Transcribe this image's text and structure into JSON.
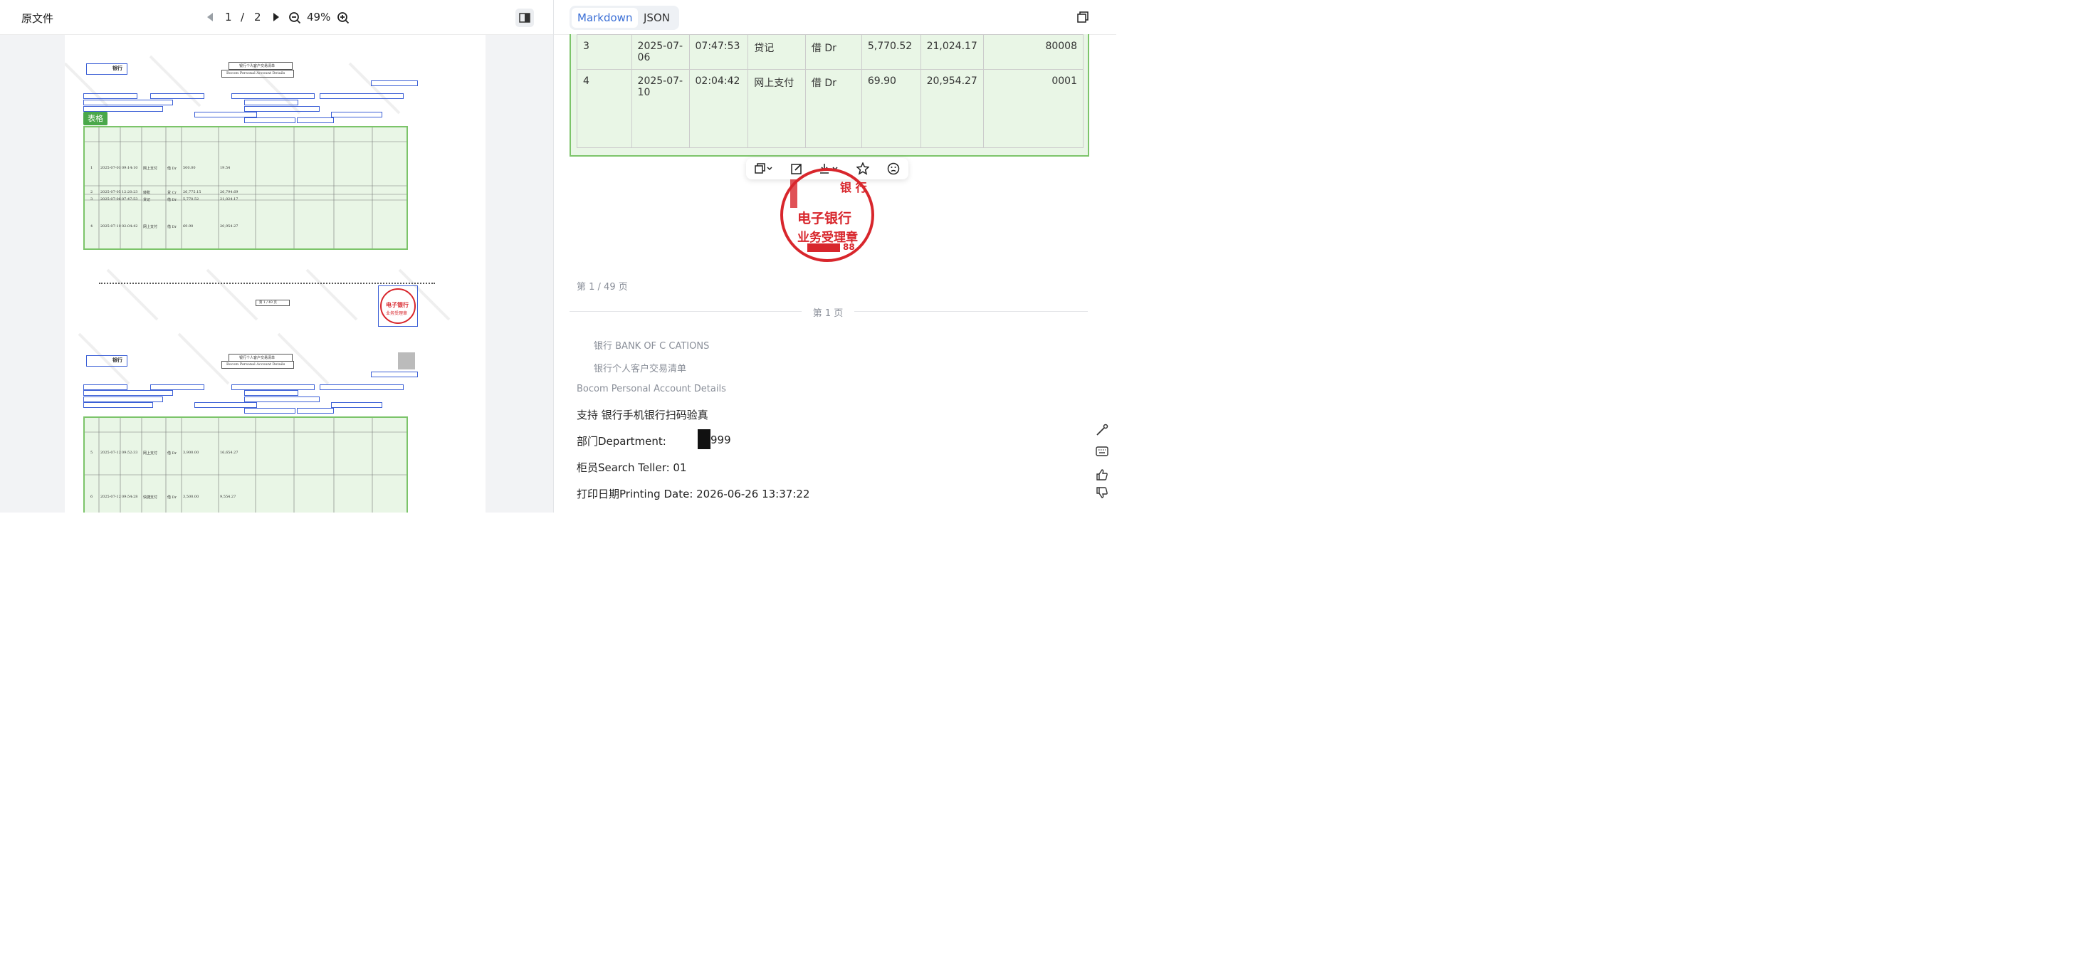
{
  "left": {
    "title": "原文件",
    "page_current": "1",
    "page_sep": "/",
    "page_total": "2",
    "zoom": "49%",
    "tag_label": "表格"
  },
  "scan": {
    "bank_logo": "银行",
    "title_cn": "银行个人客户交易清单",
    "title_en": "Bocom Personal Account Details",
    "seal_text_1": "电子银行",
    "seal_text_2": "业务受理章",
    "page_mark": "第 1 / 49 页",
    "rows": [
      {
        "serial": "1",
        "date": "2025-07-01",
        "time": "09:14:10",
        "type": "网上支付",
        "flag": "借 Dr",
        "amount": "500.00",
        "balance": "19.54"
      },
      {
        "serial": "2",
        "date": "2025-07-05",
        "time": "12:20:23",
        "type": "转账",
        "flag": "贷 Cr",
        "amount": "26,775.15",
        "balance": "26,794.69"
      },
      {
        "serial": "3",
        "date": "2025-07-06",
        "time": "07:47:53",
        "type": "贷记",
        "flag": "借 Dr",
        "amount": "5,770.52",
        "balance": "21,024.17"
      },
      {
        "serial": "4",
        "date": "2025-07-10",
        "time": "02:04:42",
        "type": "网上支付",
        "flag": "借 Dr",
        "amount": "69.90",
        "balance": "20,954.27"
      }
    ],
    "rows2": [
      {
        "serial": "5",
        "date": "2025-07-12",
        "time": "09:52:33",
        "type": "网上支付",
        "flag": "借 Dr",
        "amount": "3,900.00",
        "balance": "16,654.27"
      },
      {
        "serial": "6",
        "date": "2025-07-12",
        "time": "09:54:28",
        "type": "快捷支付",
        "flag": "借 Dr",
        "amount": "3,500.00",
        "balance": "9,554.27"
      }
    ]
  },
  "right": {
    "tab_markdown": "Markdown",
    "tab_json": "JSON",
    "table_rows": [
      {
        "c1": "3",
        "c2": "2025-07-06",
        "c3": "07:47:53",
        "c4": "贷记",
        "c5": "借 Dr",
        "c6": "5,770.52",
        "c7": "21,024.17",
        "c8": "80008"
      },
      {
        "c1": "4",
        "c2": "2025-07-10",
        "c3": "02:04:42",
        "c4": "网上支付",
        "c5": "借 Dr",
        "c6": "69.90",
        "c7": "20,954.27",
        "c8": "0001"
      }
    ],
    "seal_top": "银 行",
    "seal_line1": "电子银行",
    "seal_line2": "业务受理章",
    "seal_num": "88",
    "page_note": "第 1 / 49 页",
    "divider_label": "第 1 页",
    "line_bank": "银行 BANK OF C        CATIONS",
    "line_list_title": "银行个人客户交易清单",
    "line_en_title": "Bocom Personal Account Details",
    "line_support": "支持        银行手机银行扫码验真",
    "line_dept_label": "部门Department:",
    "line_dept_value": "999",
    "line_teller": "柜员Search Teller:            01",
    "line_print": "打印日期Printing Date: 2026-06-26 13:37:22"
  },
  "colors": {
    "accent": "#3b6fd6",
    "table_green": "#e9f6e6",
    "table_border": "#7cc46a",
    "seal_red": "#d8262c",
    "tag_green": "#4aa84a"
  }
}
